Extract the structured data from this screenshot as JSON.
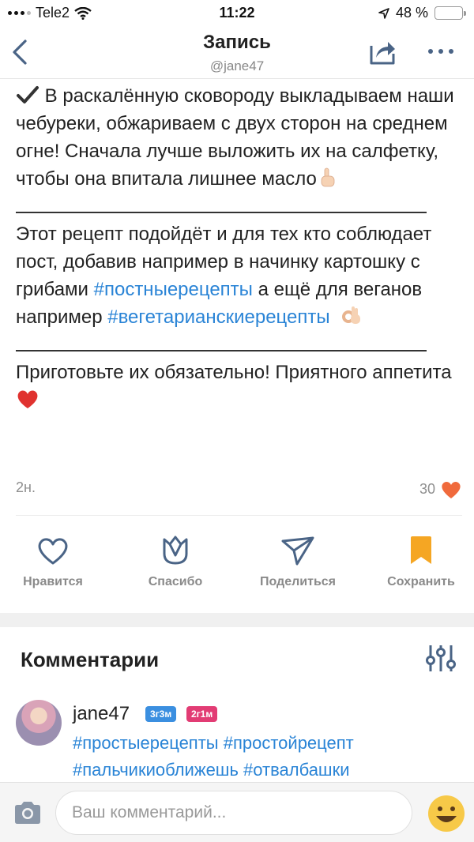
{
  "status_bar": {
    "carrier": "Tele2",
    "time": "11:22",
    "battery": "48 %"
  },
  "header": {
    "title": "Запись",
    "subtitle": "@jane47"
  },
  "post": {
    "paragraph1": "В раскалённую сковороду выкладываем наши чебуреки, обжариваем с двух сторон на среднем огне! Сначала лучше выложить их на салфетку, чтобы она впитала лишнее масло",
    "paragraph2_start": "Этот рецепт подойдёт и для тех кто соблюдает пост, добавив например в начинку картошку с грибами ",
    "hashtag1": "#постныерецепты",
    "paragraph2_middle": " а ещё для веганов например ",
    "hashtag2": "#вегетарианскиерецепты",
    "paragraph3": "Приготовьте их обязательно! Приятного аппетита",
    "time_ago": "2н.",
    "likes": "30"
  },
  "actions": {
    "like": "Нравится",
    "thanks": "Спасибо",
    "share": "Поделиться",
    "save": "Сохранить"
  },
  "comments": {
    "title": "Комментарии",
    "items": [
      {
        "author": "jane47",
        "badge1": "3г3м",
        "badge2": "2г1м",
        "tags": "#простыерецепты #простойрецепт #пальчикиоближешь #отвалбашки"
      }
    ]
  },
  "composer": {
    "placeholder": "Ваш комментарий..."
  },
  "colors": {
    "link": "#2a84d6",
    "heart": "#f06a3c",
    "save": "#f5a623",
    "icons": "#4a6486"
  }
}
